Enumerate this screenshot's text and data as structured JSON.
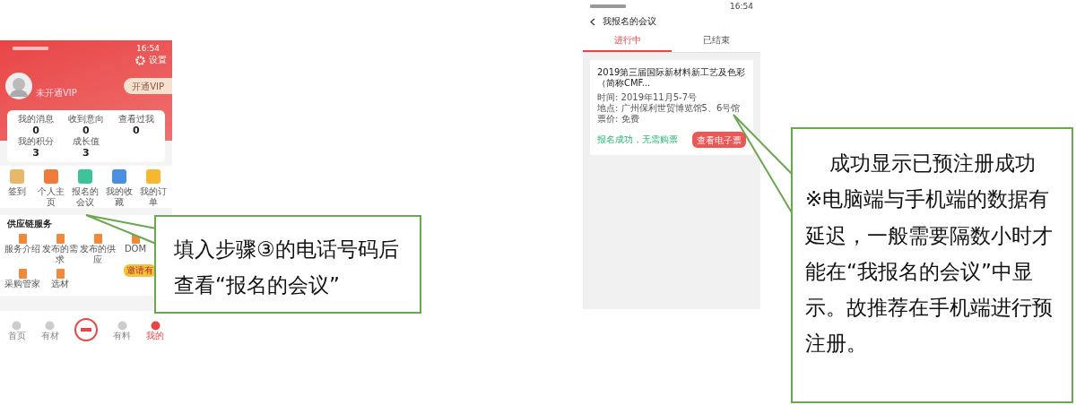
{
  "left_phone": {
    "status_time": "16:54",
    "settings": "设置",
    "vip_status": "未开通VIP",
    "vip_button": "开通VIP",
    "stats": [
      {
        "label": "我的消息",
        "value": "0"
      },
      {
        "label": "收到意向",
        "value": "0"
      },
      {
        "label": "查看过我",
        "value": "0"
      },
      {
        "label": "我的积分",
        "value": "3"
      },
      {
        "label": "成长值",
        "value": "3"
      }
    ],
    "shortcuts": [
      {
        "label": "签到",
        "color": "#e8b86a"
      },
      {
        "label": "个人主页",
        "color": "#f07a3a"
      },
      {
        "label": "报名的会议",
        "color": "#3cc39a"
      },
      {
        "label": "我的收藏",
        "color": "#4a90e2"
      },
      {
        "label": "我的订单",
        "color": "#f5b82e"
      }
    ],
    "supply_chain": {
      "title": "供应链服务",
      "items": [
        "服务介绍",
        "发布的需求",
        "发布的供应",
        "DOM",
        "采购管家",
        "选材"
      ]
    },
    "gift_badge": "邀请有",
    "bottom_nav": [
      {
        "label": "首页",
        "selected": false
      },
      {
        "label": "有材",
        "selected": false
      },
      {
        "kind": "logo",
        "selected": false
      },
      {
        "label": "有料",
        "selected": false
      },
      {
        "label": "我的",
        "selected": true
      }
    ]
  },
  "right_phone": {
    "status_time": "16:54",
    "title": "我报名的会议",
    "tabs": [
      {
        "label": "进行中",
        "selected": true
      },
      {
        "label": "已结束",
        "selected": false
      }
    ],
    "event": {
      "title": "2019第三届国际新材料新工艺及色彩（简称CMF...",
      "details": [
        "时间: 2019年11月5-7号",
        "地点: 广州保利世贸博览馆5、6号馆",
        "票价: 免费"
      ],
      "status": "报名成功，无需购票",
      "button": "查看电子票"
    }
  },
  "callouts": [
    {
      "paragraphs": [
        "填入步骤③的电话号码后查看“报名的会议”"
      ]
    },
    {
      "paragraphs": [
        "成功显示已预注册成功",
        "※电脑端与手机端的数据有延迟，一般需要隔数小时才能在“我报名的会议”中显示。故推荐在手机端进行预注册。"
      ]
    }
  ]
}
